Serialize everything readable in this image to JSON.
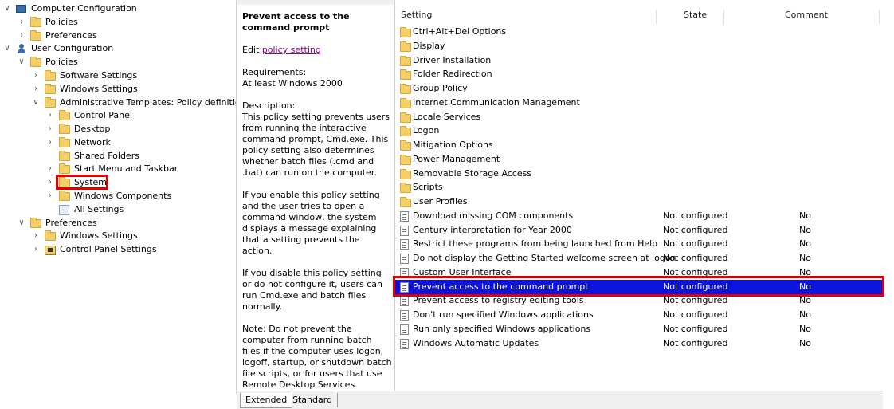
{
  "tree": {
    "nodes": [
      {
        "label": "Computer Configuration",
        "chevron": "∨",
        "icon": "pc-icon"
      },
      {
        "label": "Policies",
        "chevron": "›",
        "icon": "folder-icon"
      },
      {
        "label": "Preferences",
        "chevron": "›",
        "icon": "folder-icon"
      },
      {
        "label": "User Configuration",
        "chevron": "∨",
        "icon": "user-icon"
      },
      {
        "label": "Policies",
        "chevron": "∨",
        "icon": "folder-icon"
      },
      {
        "label": "Software Settings",
        "chevron": "›",
        "icon": "folder-icon"
      },
      {
        "label": "Windows Settings",
        "chevron": "›",
        "icon": "folder-icon"
      },
      {
        "label": "Administrative Templates: Policy definitions",
        "chevron": "∨",
        "icon": "folder-icon"
      },
      {
        "label": "Control Panel",
        "chevron": "›",
        "icon": "folder-icon"
      },
      {
        "label": "Desktop",
        "chevron": "›",
        "icon": "folder-icon"
      },
      {
        "label": "Network",
        "chevron": "›",
        "icon": "folder-icon"
      },
      {
        "label": "Shared Folders",
        "chevron": "",
        "icon": "folder-icon"
      },
      {
        "label": "Start Menu and Taskbar",
        "chevron": "›",
        "icon": "folder-icon"
      },
      {
        "label": "System",
        "chevron": "›",
        "icon": "folder-icon"
      },
      {
        "label": "Windows Components",
        "chevron": "›",
        "icon": "folder-icon"
      },
      {
        "label": "All Settings",
        "chevron": "",
        "icon": "settings-icon"
      },
      {
        "label": "Preferences",
        "chevron": "∨",
        "icon": "folder-icon"
      },
      {
        "label": "Windows Settings",
        "chevron": "›",
        "icon": "folder-icon"
      },
      {
        "label": "Control Panel Settings",
        "chevron": "›",
        "icon": "control-panel-icon"
      }
    ]
  },
  "description": {
    "title": "Prevent access to the command prompt",
    "edit_prefix": "Edit ",
    "edit_link": "policy setting",
    "requirements_label": "Requirements:",
    "requirements_value": "At least Windows 2000",
    "description_label": "Description:",
    "paragraphs": [
      "This policy setting prevents users from running the interactive command prompt, Cmd.exe.  This policy setting also determines whether batch files (.cmd and .bat) can run on the computer.",
      "If you enable this policy setting and the user tries to open a command window, the system displays a message explaining that a setting prevents the action.",
      "If you disable this policy setting or do not configure it, users can run Cmd.exe and batch files normally.",
      "Note: Do not prevent the computer from running batch files if the computer uses logon, logoff, startup, or shutdown batch file scripts, or for users that use Remote Desktop Services."
    ]
  },
  "list": {
    "columns": {
      "setting": "Setting",
      "state": "State",
      "comment": "Comment"
    },
    "rows": [
      {
        "name": "Ctrl+Alt+Del Options",
        "state": "",
        "comment": "",
        "icon": "folder-icon"
      },
      {
        "name": "Display",
        "state": "",
        "comment": "",
        "icon": "folder-icon"
      },
      {
        "name": "Driver Installation",
        "state": "",
        "comment": "",
        "icon": "folder-icon"
      },
      {
        "name": "Folder Redirection",
        "state": "",
        "comment": "",
        "icon": "folder-icon"
      },
      {
        "name": "Group Policy",
        "state": "",
        "comment": "",
        "icon": "folder-icon"
      },
      {
        "name": "Internet Communication Management",
        "state": "",
        "comment": "",
        "icon": "folder-icon"
      },
      {
        "name": "Locale Services",
        "state": "",
        "comment": "",
        "icon": "folder-icon"
      },
      {
        "name": "Logon",
        "state": "",
        "comment": "",
        "icon": "folder-icon"
      },
      {
        "name": "Mitigation Options",
        "state": "",
        "comment": "",
        "icon": "folder-icon"
      },
      {
        "name": "Power Management",
        "state": "",
        "comment": "",
        "icon": "folder-icon"
      },
      {
        "name": "Removable Storage Access",
        "state": "",
        "comment": "",
        "icon": "folder-icon"
      },
      {
        "name": "Scripts",
        "state": "",
        "comment": "",
        "icon": "folder-icon"
      },
      {
        "name": "User Profiles",
        "state": "",
        "comment": "",
        "icon": "folder-icon"
      },
      {
        "name": "Download missing COM components",
        "state": "Not configured",
        "comment": "No",
        "icon": "policy-icon"
      },
      {
        "name": "Century interpretation for Year 2000",
        "state": "Not configured",
        "comment": "No",
        "icon": "policy-icon"
      },
      {
        "name": "Restrict these programs from being launched from Help",
        "state": "Not configured",
        "comment": "No",
        "icon": "policy-icon"
      },
      {
        "name": "Do not display the Getting Started welcome screen at logon",
        "state": "Not configured",
        "comment": "No",
        "icon": "policy-icon"
      },
      {
        "name": "Custom User Interface",
        "state": "Not configured",
        "comment": "No",
        "icon": "policy-icon"
      },
      {
        "name": "Prevent access to the command prompt",
        "state": "Not configured",
        "comment": "No",
        "icon": "policy-icon",
        "selected": true
      },
      {
        "name": "Prevent access to registry editing tools",
        "state": "Not configured",
        "comment": "No",
        "icon": "policy-icon"
      },
      {
        "name": "Don't run specified Windows applications",
        "state": "Not configured",
        "comment": "No",
        "icon": "policy-icon"
      },
      {
        "name": "Run only specified Windows applications",
        "state": "Not configured",
        "comment": "No",
        "icon": "policy-icon"
      },
      {
        "name": "Windows Automatic Updates",
        "state": "Not configured",
        "comment": "No",
        "icon": "policy-icon"
      }
    ]
  },
  "tabs": {
    "extended": "Extended",
    "standard": "Standard"
  },
  "colors": {
    "selection": "#0c13dc",
    "highlight": "#e00000",
    "folder": "#f2cf6a",
    "link": "#8b008b"
  }
}
